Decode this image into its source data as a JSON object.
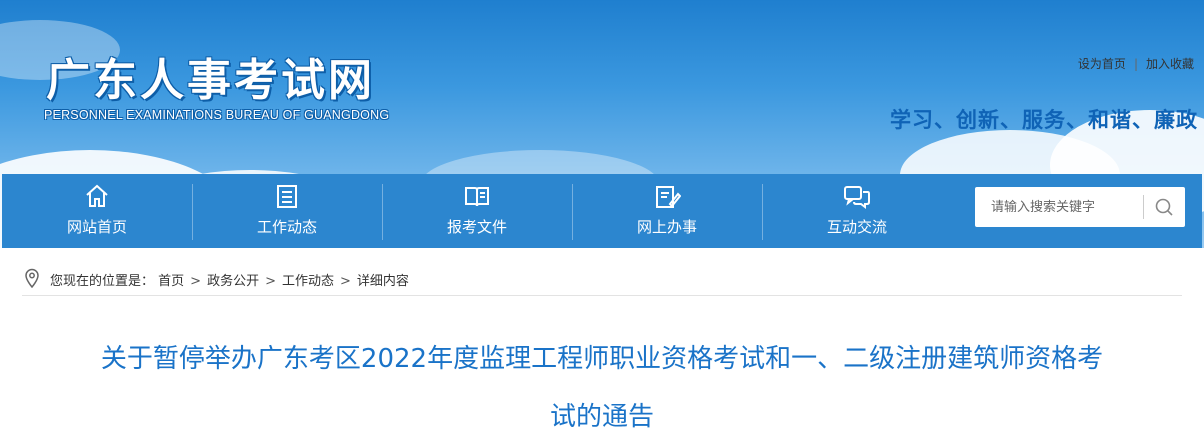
{
  "header": {
    "site_title": "广东人事考试网",
    "site_subtitle": "PERSONNEL EXAMINATIONS BUREAU OF GUANGDONG",
    "top_links": [
      "设为首页",
      "加入收藏"
    ],
    "slogan": "学习、创新、服务、和谐、廉政"
  },
  "nav": {
    "items": [
      {
        "label": "网站首页",
        "icon": "home-icon"
      },
      {
        "label": "工作动态",
        "icon": "news-icon"
      },
      {
        "label": "报考文件",
        "icon": "book-icon"
      },
      {
        "label": "网上办事",
        "icon": "edit-icon"
      },
      {
        "label": "互动交流",
        "icon": "chat-icon"
      }
    ],
    "search": {
      "placeholder": "请输入搜索关键字",
      "icon": "search-icon"
    }
  },
  "breadcrumb": {
    "prefix": "您现在的位置是：",
    "items": [
      "首页",
      "政务公开",
      "工作动态",
      "详细内容"
    ],
    "separator": ">",
    "icon": "location-pin-icon"
  },
  "article": {
    "title_line1": "关于暂停举办广东考区2022年度监理工程师职业资格考试和一、二级注册建筑师资格考",
    "title_line2": "试的通告"
  },
  "colors": {
    "nav_bg": "#2c86cf",
    "slogan": "#0f63b6",
    "title": "#1a73c8"
  }
}
